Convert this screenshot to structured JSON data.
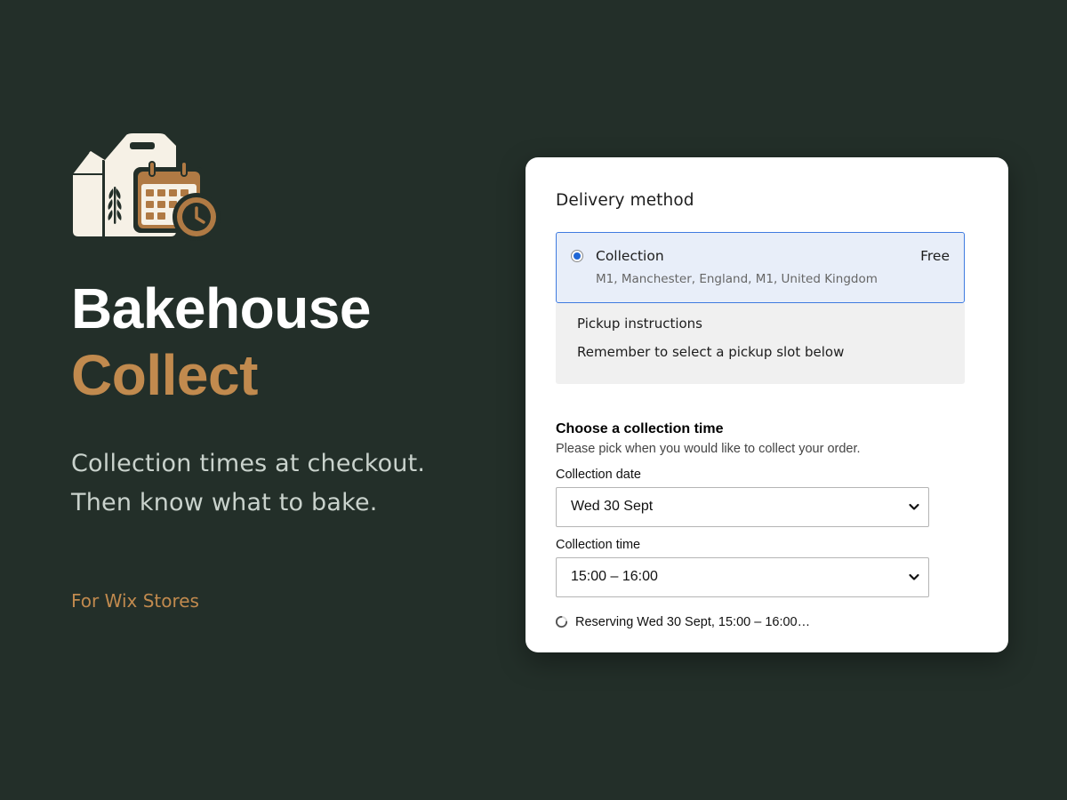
{
  "brand": {
    "logo_icon": "bakery-box-calendar-clock-icon",
    "title_line1": "Bakehouse",
    "title_line2": "Collect",
    "tagline_line1": "Collection times at checkout.",
    "tagline_line2": "Then know what to bake.",
    "platform": "For Wix Stores"
  },
  "colors": {
    "background": "#232f29",
    "accent": "#c18a4e",
    "title": "#ffffff",
    "tagline": "#c9d2cc",
    "selected_border": "#3f7be0",
    "selected_bg": "#e8eef9",
    "radio_dot": "#1f66d6"
  },
  "checkout": {
    "section_title": "Delivery method",
    "delivery_option": {
      "selected": true,
      "name": "Collection",
      "price": "Free",
      "address": "M1, Manchester, England, M1, United Kingdom"
    },
    "pickup": {
      "title": "Pickup instructions",
      "text": "Remember to select a pickup slot below"
    },
    "collection": {
      "title": "Choose a collection time",
      "subtitle": "Please pick when you would like to collect your order.",
      "date_label": "Collection date",
      "date_value": "Wed 30 Sept",
      "time_label": "Collection time",
      "time_value": "15:00 – 16:00",
      "status": "Reserving Wed 30 Sept, 15:00 – 16:00…"
    }
  }
}
